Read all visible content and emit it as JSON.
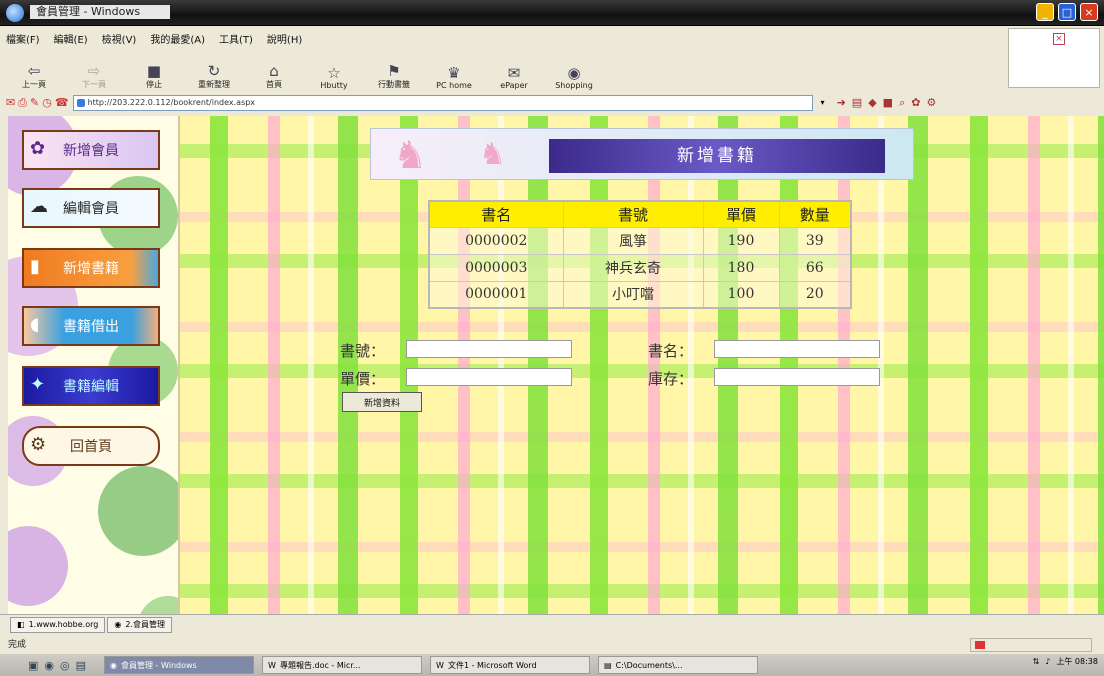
{
  "window": {
    "title": "會員管理 - Windows",
    "app_icon": "globe-icon"
  },
  "menu": [
    "檔案(F)",
    "編輯(E)",
    "檢視(V)",
    "我的最愛(A)",
    "工具(T)",
    "說明(H)"
  ],
  "toolbar": [
    {
      "label": "上一頁",
      "icon": "back-arrow-icon",
      "enabled": true
    },
    {
      "label": "下一頁",
      "icon": "forward-arrow-icon",
      "enabled": false
    },
    {
      "label": "停止",
      "icon": "stop-icon",
      "enabled": true
    },
    {
      "label": "重新整理",
      "icon": "refresh-icon",
      "enabled": true
    },
    {
      "label": "首頁",
      "icon": "home-icon",
      "enabled": true
    },
    {
      "label": "Hbutty",
      "icon": "favorites-icon",
      "enabled": true
    },
    {
      "label": "行動書籤",
      "icon": "bookmark-icon",
      "enabled": true
    },
    {
      "label": "PC home",
      "icon": "pchome-icon",
      "enabled": true
    },
    {
      "label": "ePaper",
      "icon": "epaper-icon",
      "enabled": true
    },
    {
      "label": "Shopping",
      "icon": "shopping-icon",
      "enabled": true
    }
  ],
  "address": {
    "url": "http://203.222.0.112/bookrent/index.aspx"
  },
  "sidebar": {
    "items": [
      {
        "label": "新增會員",
        "icon": "flower-icon"
      },
      {
        "label": "編輯會員",
        "icon": "cloud-icon"
      },
      {
        "label": "新增書籍",
        "icon": "bar-icon"
      },
      {
        "label": "書籍借出",
        "icon": "bottle-icon"
      },
      {
        "label": "書籍編輯",
        "icon": "sparkle-icon"
      },
      {
        "label": "回首頁",
        "icon": "bone-icon"
      }
    ]
  },
  "page": {
    "heading": "新增書籍"
  },
  "books": {
    "columns": [
      "書名",
      "書號",
      "單價",
      "數量"
    ],
    "rows": [
      [
        "0000002",
        "風箏",
        "190",
        "39"
      ],
      [
        "0000003",
        "神兵玄奇",
        "180",
        "66"
      ],
      [
        "0000001",
        "小叮噹",
        "100",
        "20"
      ]
    ]
  },
  "form": {
    "book_no_label": "書號：",
    "book_name_label": "書名：",
    "price_label": "單價：",
    "stock_label": "庫存：",
    "book_no_value": "",
    "book_name_value": "",
    "price_value": "",
    "stock_value": "",
    "submit_label": "新增資料"
  },
  "bottom_tabs": [
    "1.www.hobbe.org",
    "2.會員管理"
  ],
  "status": {
    "text": "完成"
  },
  "taskbar": {
    "tasks": [
      "會員管理 - Windows",
      "專題報告.doc - Micr...",
      "文件1 - Microsoft Word",
      "C:\\Documents\\..."
    ],
    "clock": "上午 08:38"
  },
  "colors": {
    "table_header": "#ffee00",
    "banner_bar": "#3b2a8a",
    "plaid_green": "#8ce63c",
    "plaid_pink": "#ffaad2"
  }
}
